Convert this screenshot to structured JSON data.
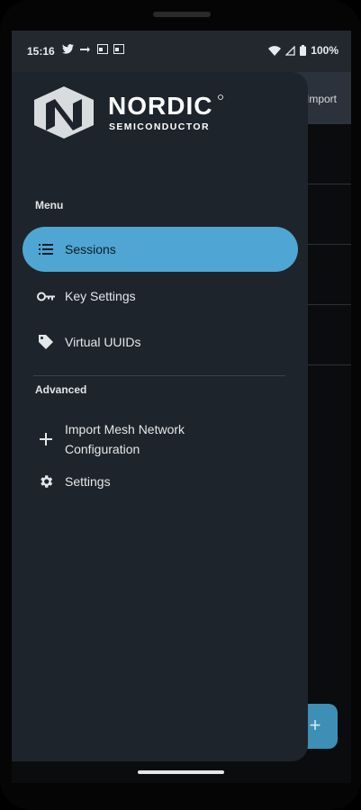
{
  "status_bar": {
    "time": "15:16",
    "battery": "100%"
  },
  "app_toolbar": {
    "action_label": "Import"
  },
  "drawer": {
    "brand": {
      "name": "NORDIC",
      "sub": "SEMICONDUCTOR"
    },
    "sections": {
      "menu_label": "Menu",
      "advanced_label": "Advanced"
    },
    "menu_items": [
      {
        "label": "Sessions",
        "icon": "list-icon",
        "active": true
      },
      {
        "label": "Key Settings",
        "icon": "key-icon",
        "active": false
      },
      {
        "label": "Virtual UUIDs",
        "icon": "tag-icon",
        "active": false
      }
    ],
    "advanced_items": [
      {
        "label_line1": "Import Mesh Network",
        "label_line2": "Configuration",
        "icon": "plus-icon"
      },
      {
        "label": "Settings",
        "icon": "gear-icon"
      }
    ]
  },
  "fab": {
    "icon": "plus-icon"
  },
  "colors": {
    "accent": "#4fa6d2",
    "drawer_bg": "#1e242b",
    "status_bg": "#23282f"
  }
}
